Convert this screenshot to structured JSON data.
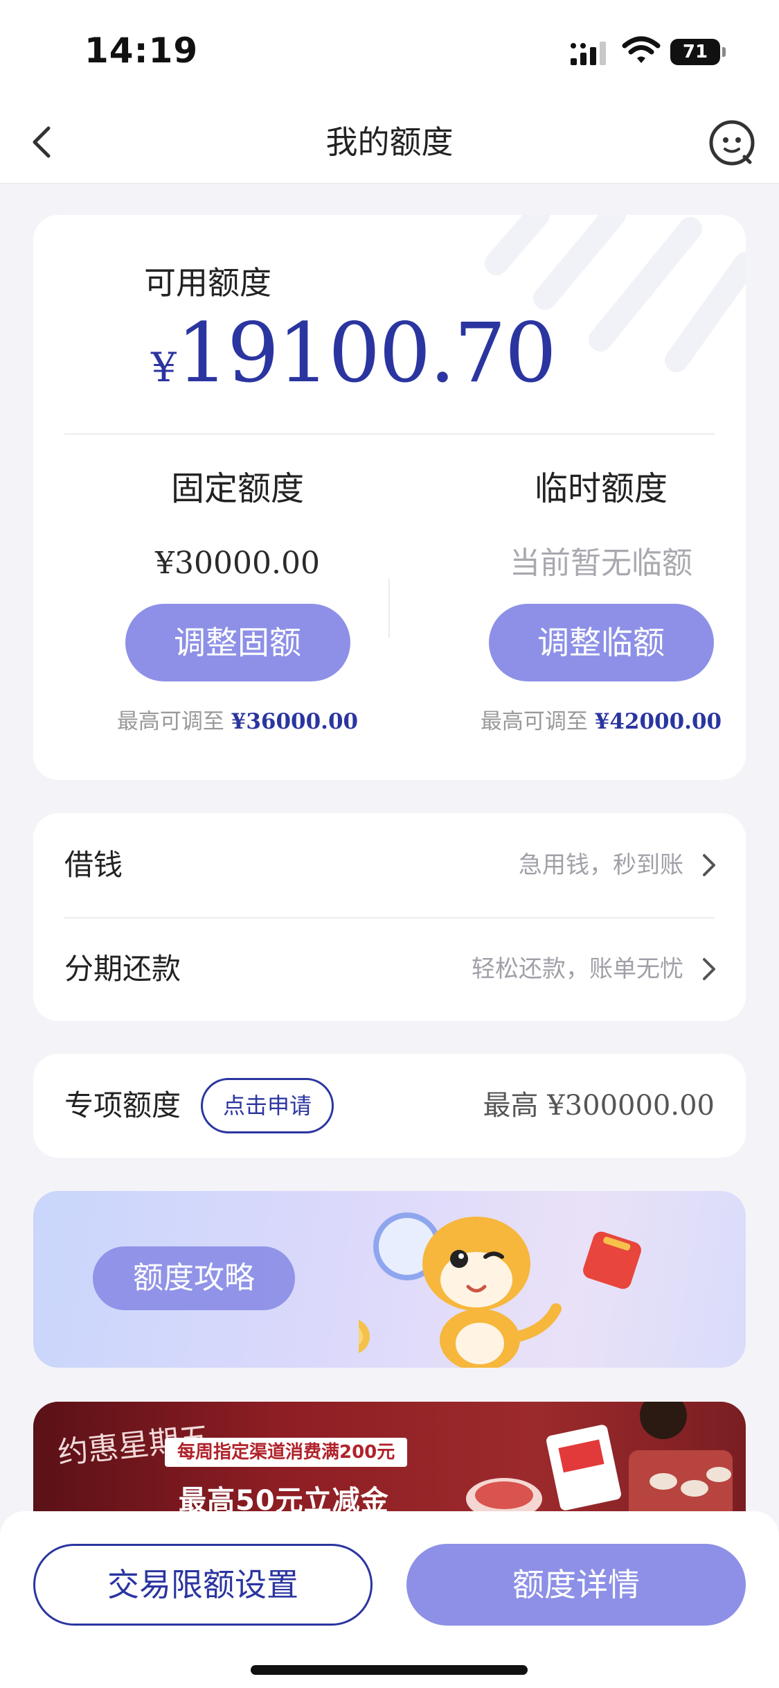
{
  "status_bar": {
    "time": "14:19",
    "battery": "71"
  },
  "nav": {
    "title": "我的额度"
  },
  "quota": {
    "available_label": "可用额度",
    "currency": "¥",
    "available_amount": "19100.70",
    "fixed": {
      "title": "固定额度",
      "value": "¥30000.00",
      "button": "调整固额",
      "max_prefix": "最高可调至",
      "max_value": "¥36000.00"
    },
    "temp": {
      "title": "临时额度",
      "value": "当前暂无临额",
      "button": "调整临额",
      "max_prefix": "最高可调至",
      "max_value": "¥42000.00"
    }
  },
  "services": [
    {
      "title": "借钱",
      "subtitle": "急用钱，秒到账"
    },
    {
      "title": "分期还款",
      "subtitle": "轻松还款，账单无忧"
    }
  ],
  "special": {
    "title": "专项额度",
    "apply_label": "点击申请",
    "max_prefix": "最高",
    "max_value": "¥300000.00"
  },
  "strategy_banner": {
    "label": "额度攻略"
  },
  "promo_banner": {
    "logo": "约惠星期五",
    "tag": "每周指定渠道消费满200元",
    "headline": "最高50元立减金"
  },
  "bottom": {
    "limit_button": "交易限额设置",
    "detail_button": "额度详情"
  },
  "colors": {
    "accent": "#8d90e6",
    "brand": "#2b35a0"
  }
}
